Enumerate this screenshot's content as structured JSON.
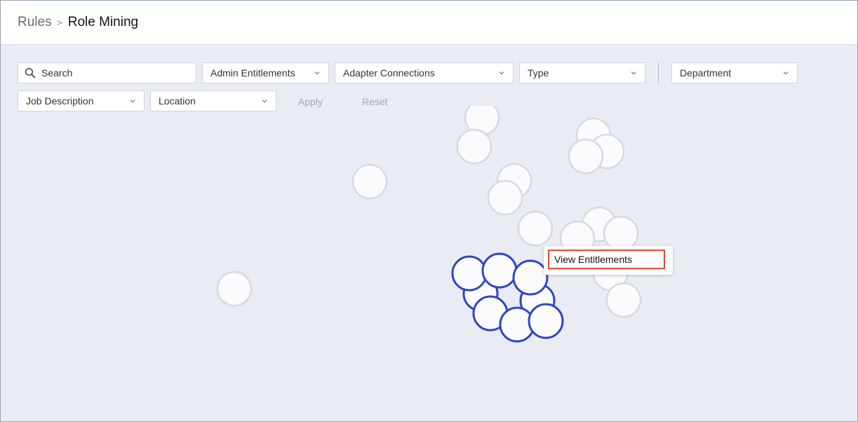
{
  "breadcrumb": {
    "parent": "Rules",
    "current": "Role Mining"
  },
  "filters": {
    "search_label": "Search",
    "admin_entitlements": "Admin Entitlements",
    "adapter_connections": "Adapter Connections",
    "type": "Type",
    "department": "Department",
    "job_description": "Job Description",
    "location": "Location",
    "apply": "Apply",
    "reset": "Reset"
  },
  "context_menu": {
    "view_entitlements": "View Entitlements"
  },
  "colors": {
    "selected_stroke": "#2f45c4",
    "node_stroke": "#d6d9e2",
    "node_fill": "#fbfbfd",
    "highlight_border": "#e24b37"
  },
  "icons": {
    "search": "search-icon",
    "dropdown": "chevron-down-icon"
  }
}
